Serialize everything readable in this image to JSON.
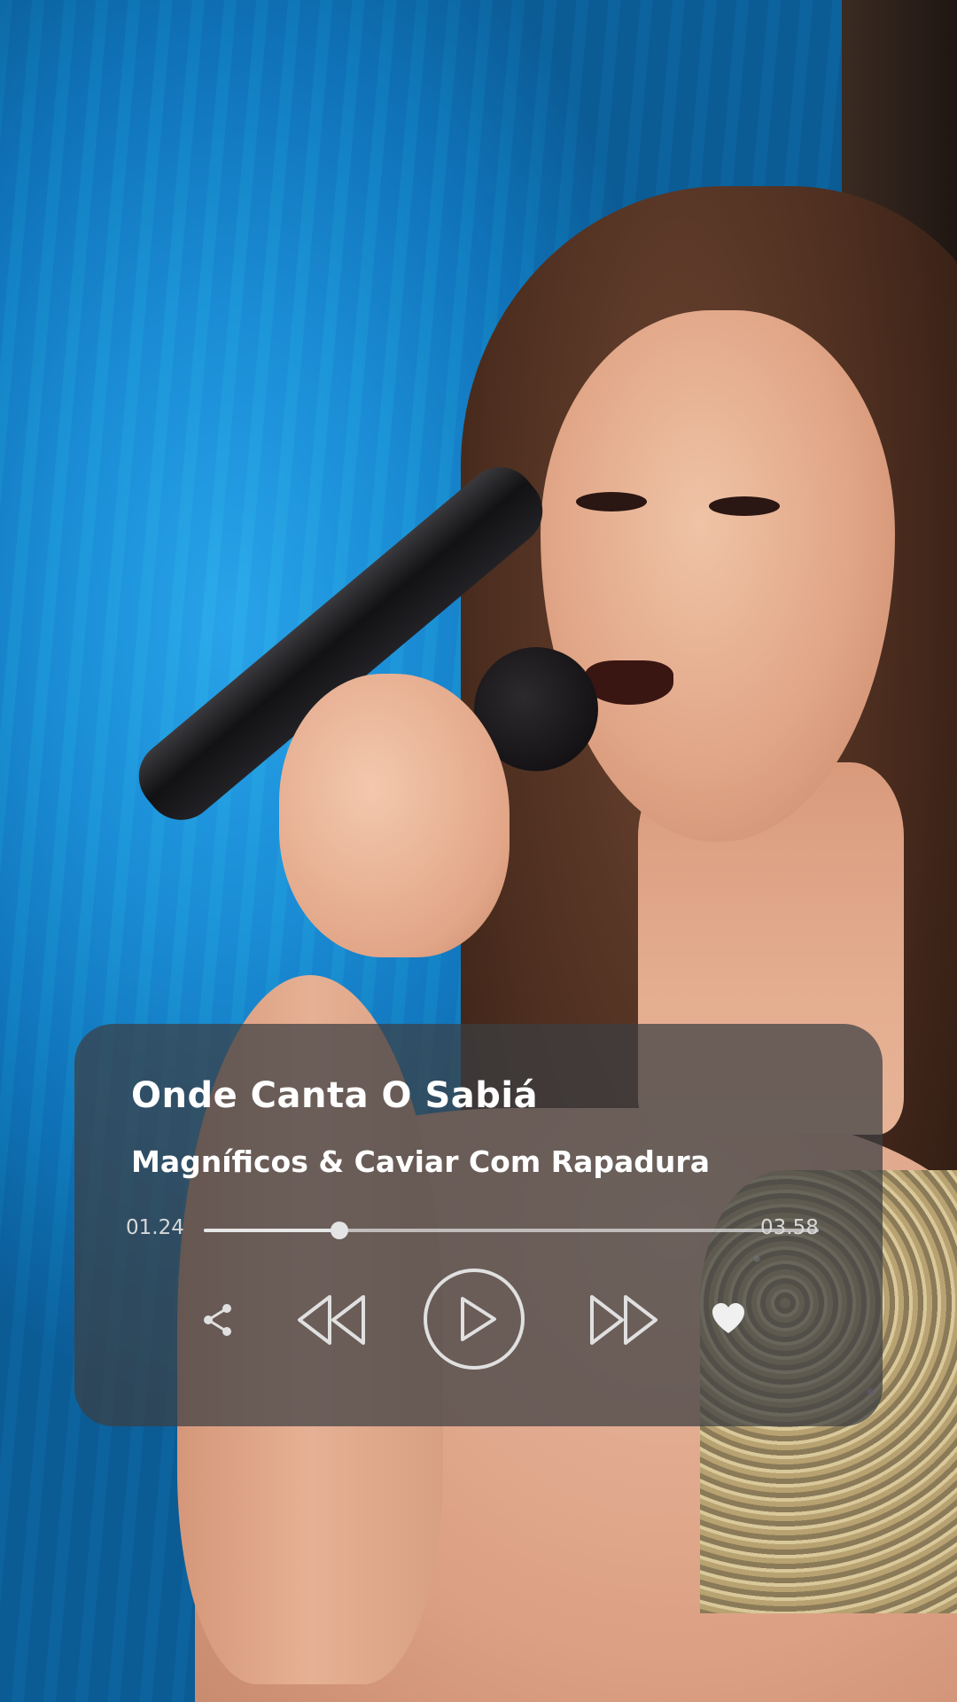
{
  "player": {
    "song_title": "Onde Canta O Sabiá",
    "artist": "Magníficos & Caviar Com Rapadura",
    "time_current": "01.24",
    "time_total": "03.58",
    "progress_fraction": 0.22,
    "is_playing": false
  },
  "controls": {
    "share_icon": "share-icon",
    "rewind_icon": "rewind-icon",
    "play_icon": "play-icon",
    "forward_icon": "fast-forward-icon",
    "like_icon": "heart-icon"
  },
  "colors": {
    "card_background": "#3c3e42",
    "text": "#ffffff",
    "icon_stroke": "#e0e0e0",
    "background_blue": "#1a8fd6"
  }
}
